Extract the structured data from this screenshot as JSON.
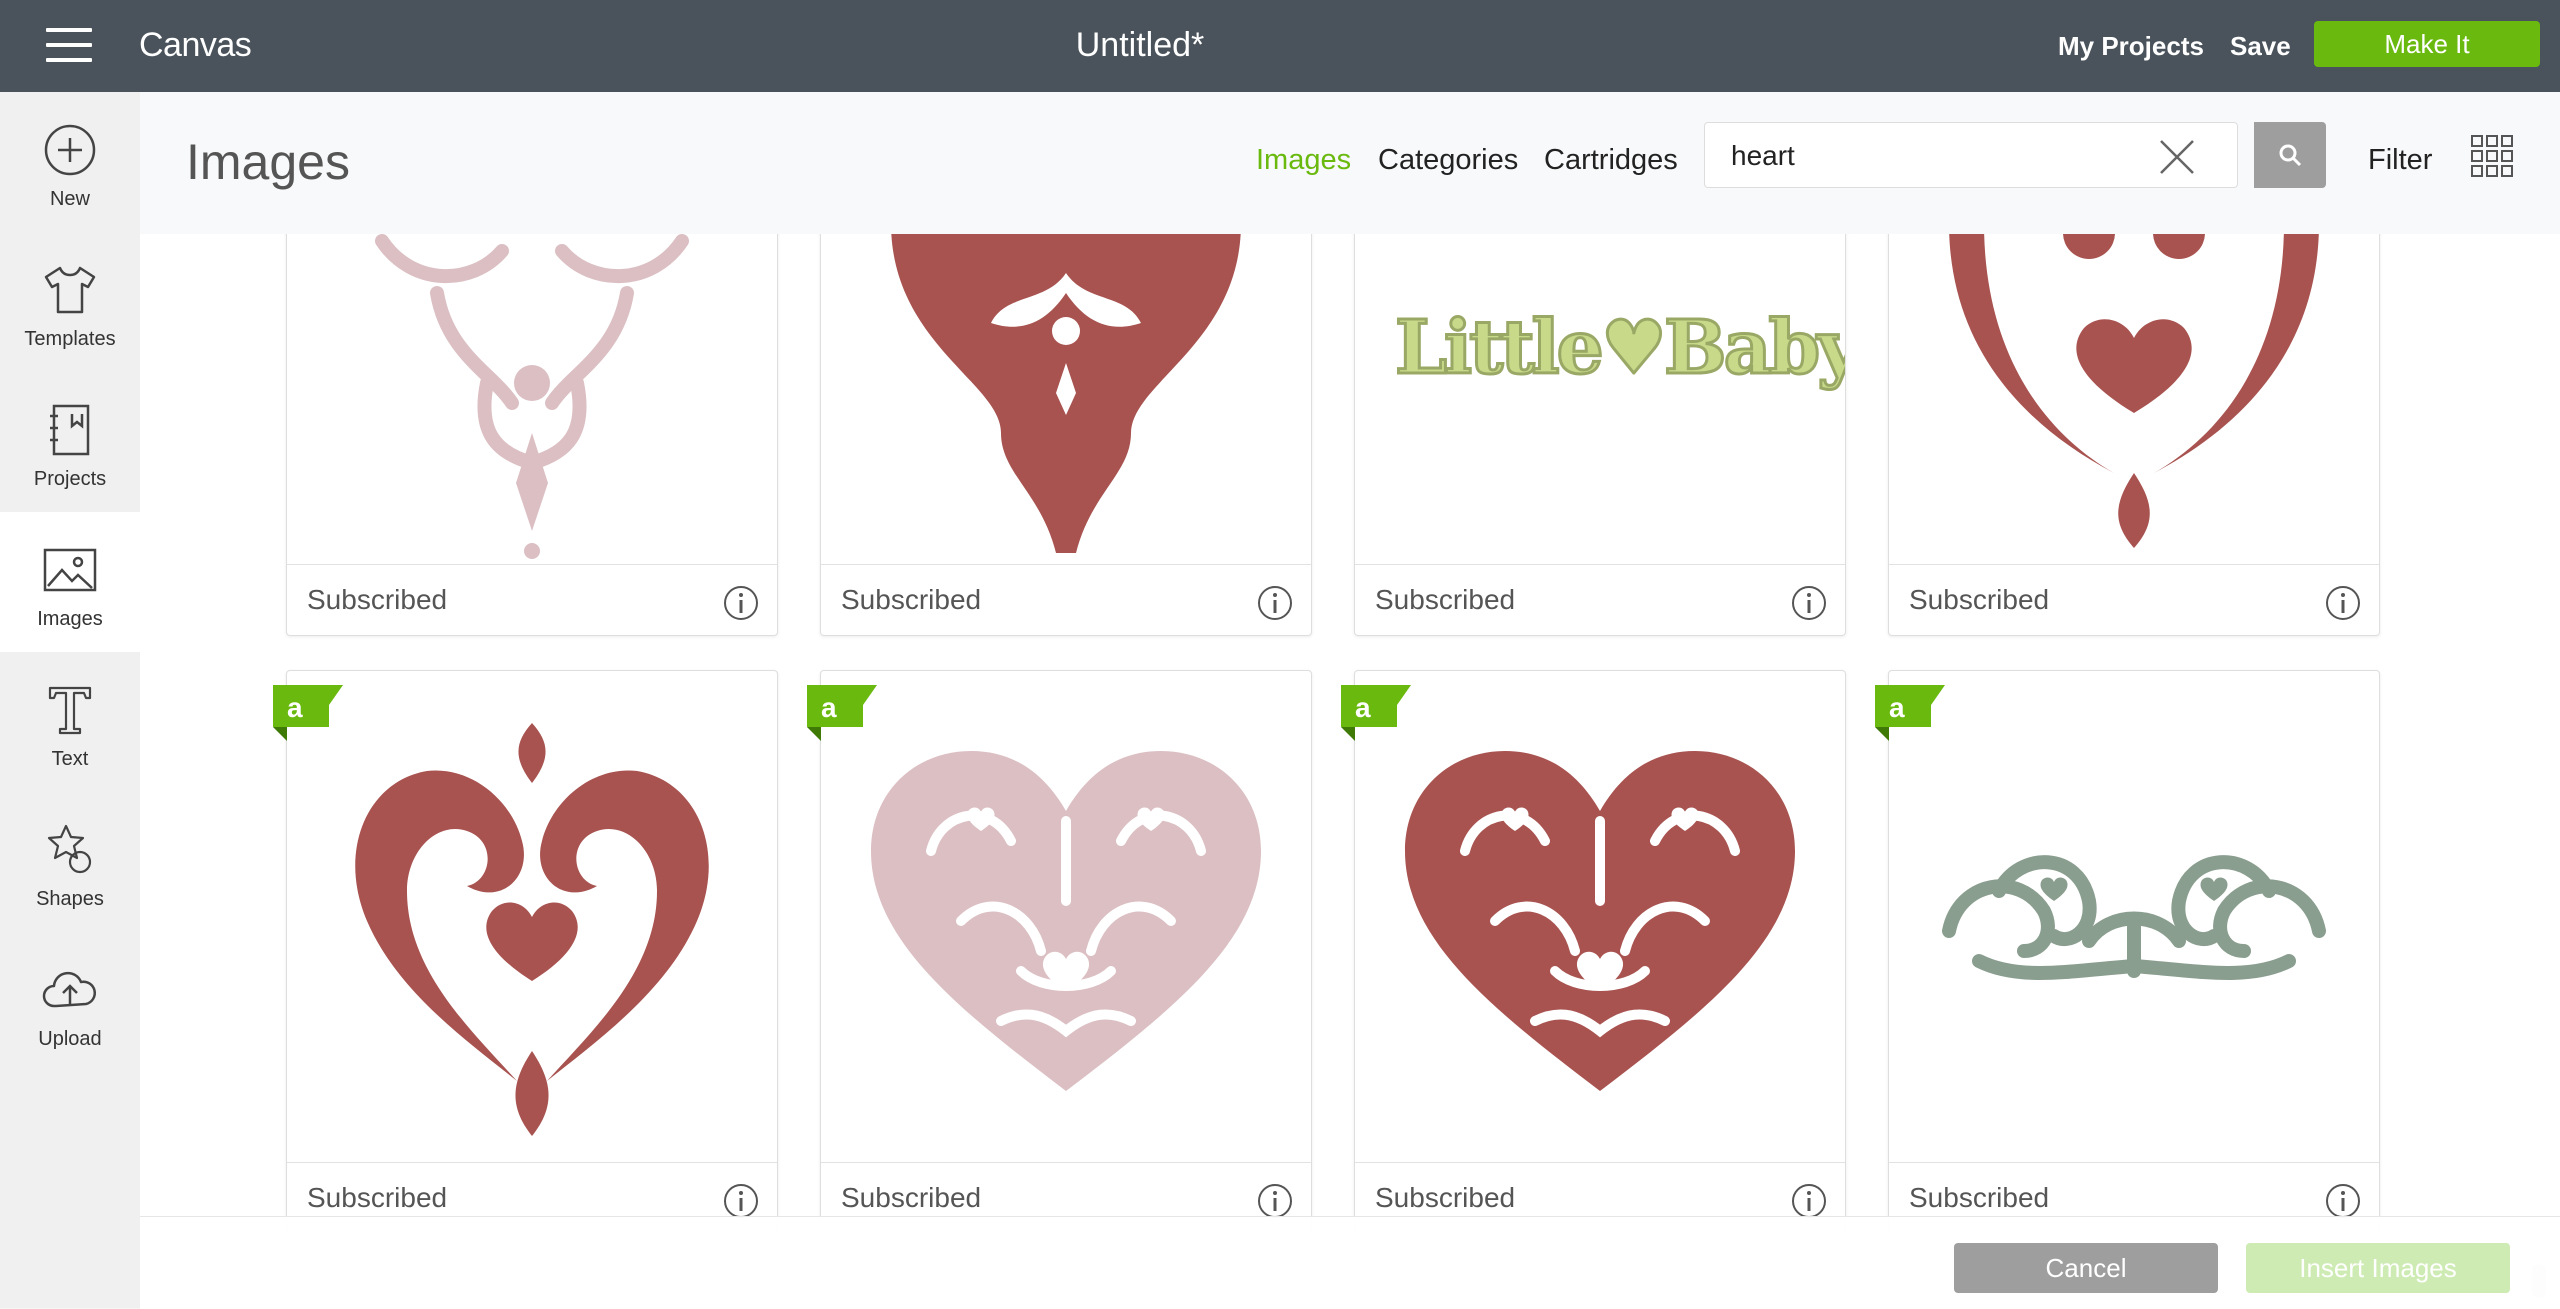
{
  "topbar": {
    "brand": "Canvas",
    "doc_title": "Untitled*",
    "my_projects": "My Projects",
    "save": "Save",
    "make_it": "Make It"
  },
  "sidebar": {
    "items": [
      {
        "label": "New",
        "icon": "plus-circle-icon"
      },
      {
        "label": "Templates",
        "icon": "tshirt-icon"
      },
      {
        "label": "Projects",
        "icon": "notebook-icon"
      },
      {
        "label": "Images",
        "icon": "image-icon",
        "active": true
      },
      {
        "label": "Text",
        "icon": "text-icon"
      },
      {
        "label": "Shapes",
        "icon": "shapes-icon"
      },
      {
        "label": "Upload",
        "icon": "cloud-upload-icon"
      }
    ]
  },
  "panel": {
    "title": "Images",
    "tabs": [
      {
        "label": "Images",
        "active": true
      },
      {
        "label": "Categories"
      },
      {
        "label": "Cartridges"
      }
    ],
    "search": {
      "value": "heart"
    },
    "filter": "Filter"
  },
  "colors": {
    "accent_green": "#6ab90f",
    "topbar": "#4a535b",
    "dusty_red": "#a85350",
    "pale_pink": "#dbbfc3",
    "sage": "#8a9e8f",
    "lime": "#c9d98a"
  },
  "cards": [
    {
      "status": "Subscribed",
      "art": "pink-ornament"
    },
    {
      "status": "Subscribed",
      "art": "red-ornament"
    },
    {
      "status": "Subscribed",
      "art": "little-baby-text",
      "text": "Little♥Baby"
    },
    {
      "status": "Subscribed",
      "art": "red-swirl-heart-top"
    },
    {
      "status": "Subscribed",
      "art": "red-swirl-heart",
      "badge": "a"
    },
    {
      "status": "Subscribed",
      "art": "pink-filigree-heart",
      "badge": "a"
    },
    {
      "status": "Subscribed",
      "art": "red-filigree-heart",
      "badge": "a"
    },
    {
      "status": "Subscribed",
      "art": "sage-heart-border",
      "badge": "a"
    }
  ],
  "actions": {
    "cancel": "Cancel",
    "insert": "Insert Images"
  }
}
